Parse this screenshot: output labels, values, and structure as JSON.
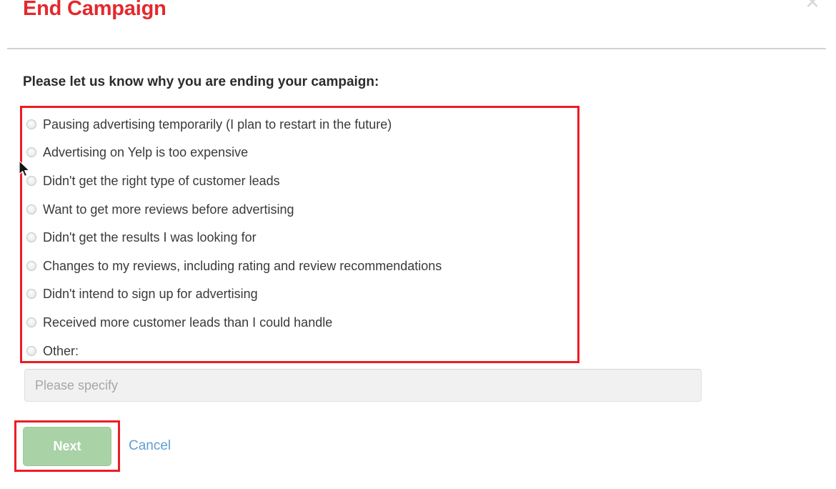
{
  "modal": {
    "title": "End Campaign",
    "close_icon": "close-icon",
    "close_glyph": "✕",
    "prompt": "Please let us know why you are ending your campaign:",
    "accent_red": "#e4282c",
    "highlight_red": "#ed1c24",
    "link_blue": "#5e9fd4",
    "next_green": "#a9d3a6"
  },
  "reasons": {
    "selected_index": 2,
    "options": [
      {
        "label": "Pausing advertising temporarily (I plan to restart in the future)"
      },
      {
        "label": "Advertising on Yelp is too expensive"
      },
      {
        "label": "Didn't get the right type of customer leads"
      },
      {
        "label": "Want to get more reviews before advertising"
      },
      {
        "label": "Didn't get the results I was looking for"
      },
      {
        "label": "Changes to my reviews, including rating and review recommendations"
      },
      {
        "label": "Didn't intend to sign up for advertising"
      },
      {
        "label": "Received more customer leads than I could handle"
      },
      {
        "label": "Other:"
      }
    ]
  },
  "specify": {
    "placeholder": "Please specify",
    "value": ""
  },
  "actions": {
    "next_label": "Next",
    "cancel_label": "Cancel"
  }
}
